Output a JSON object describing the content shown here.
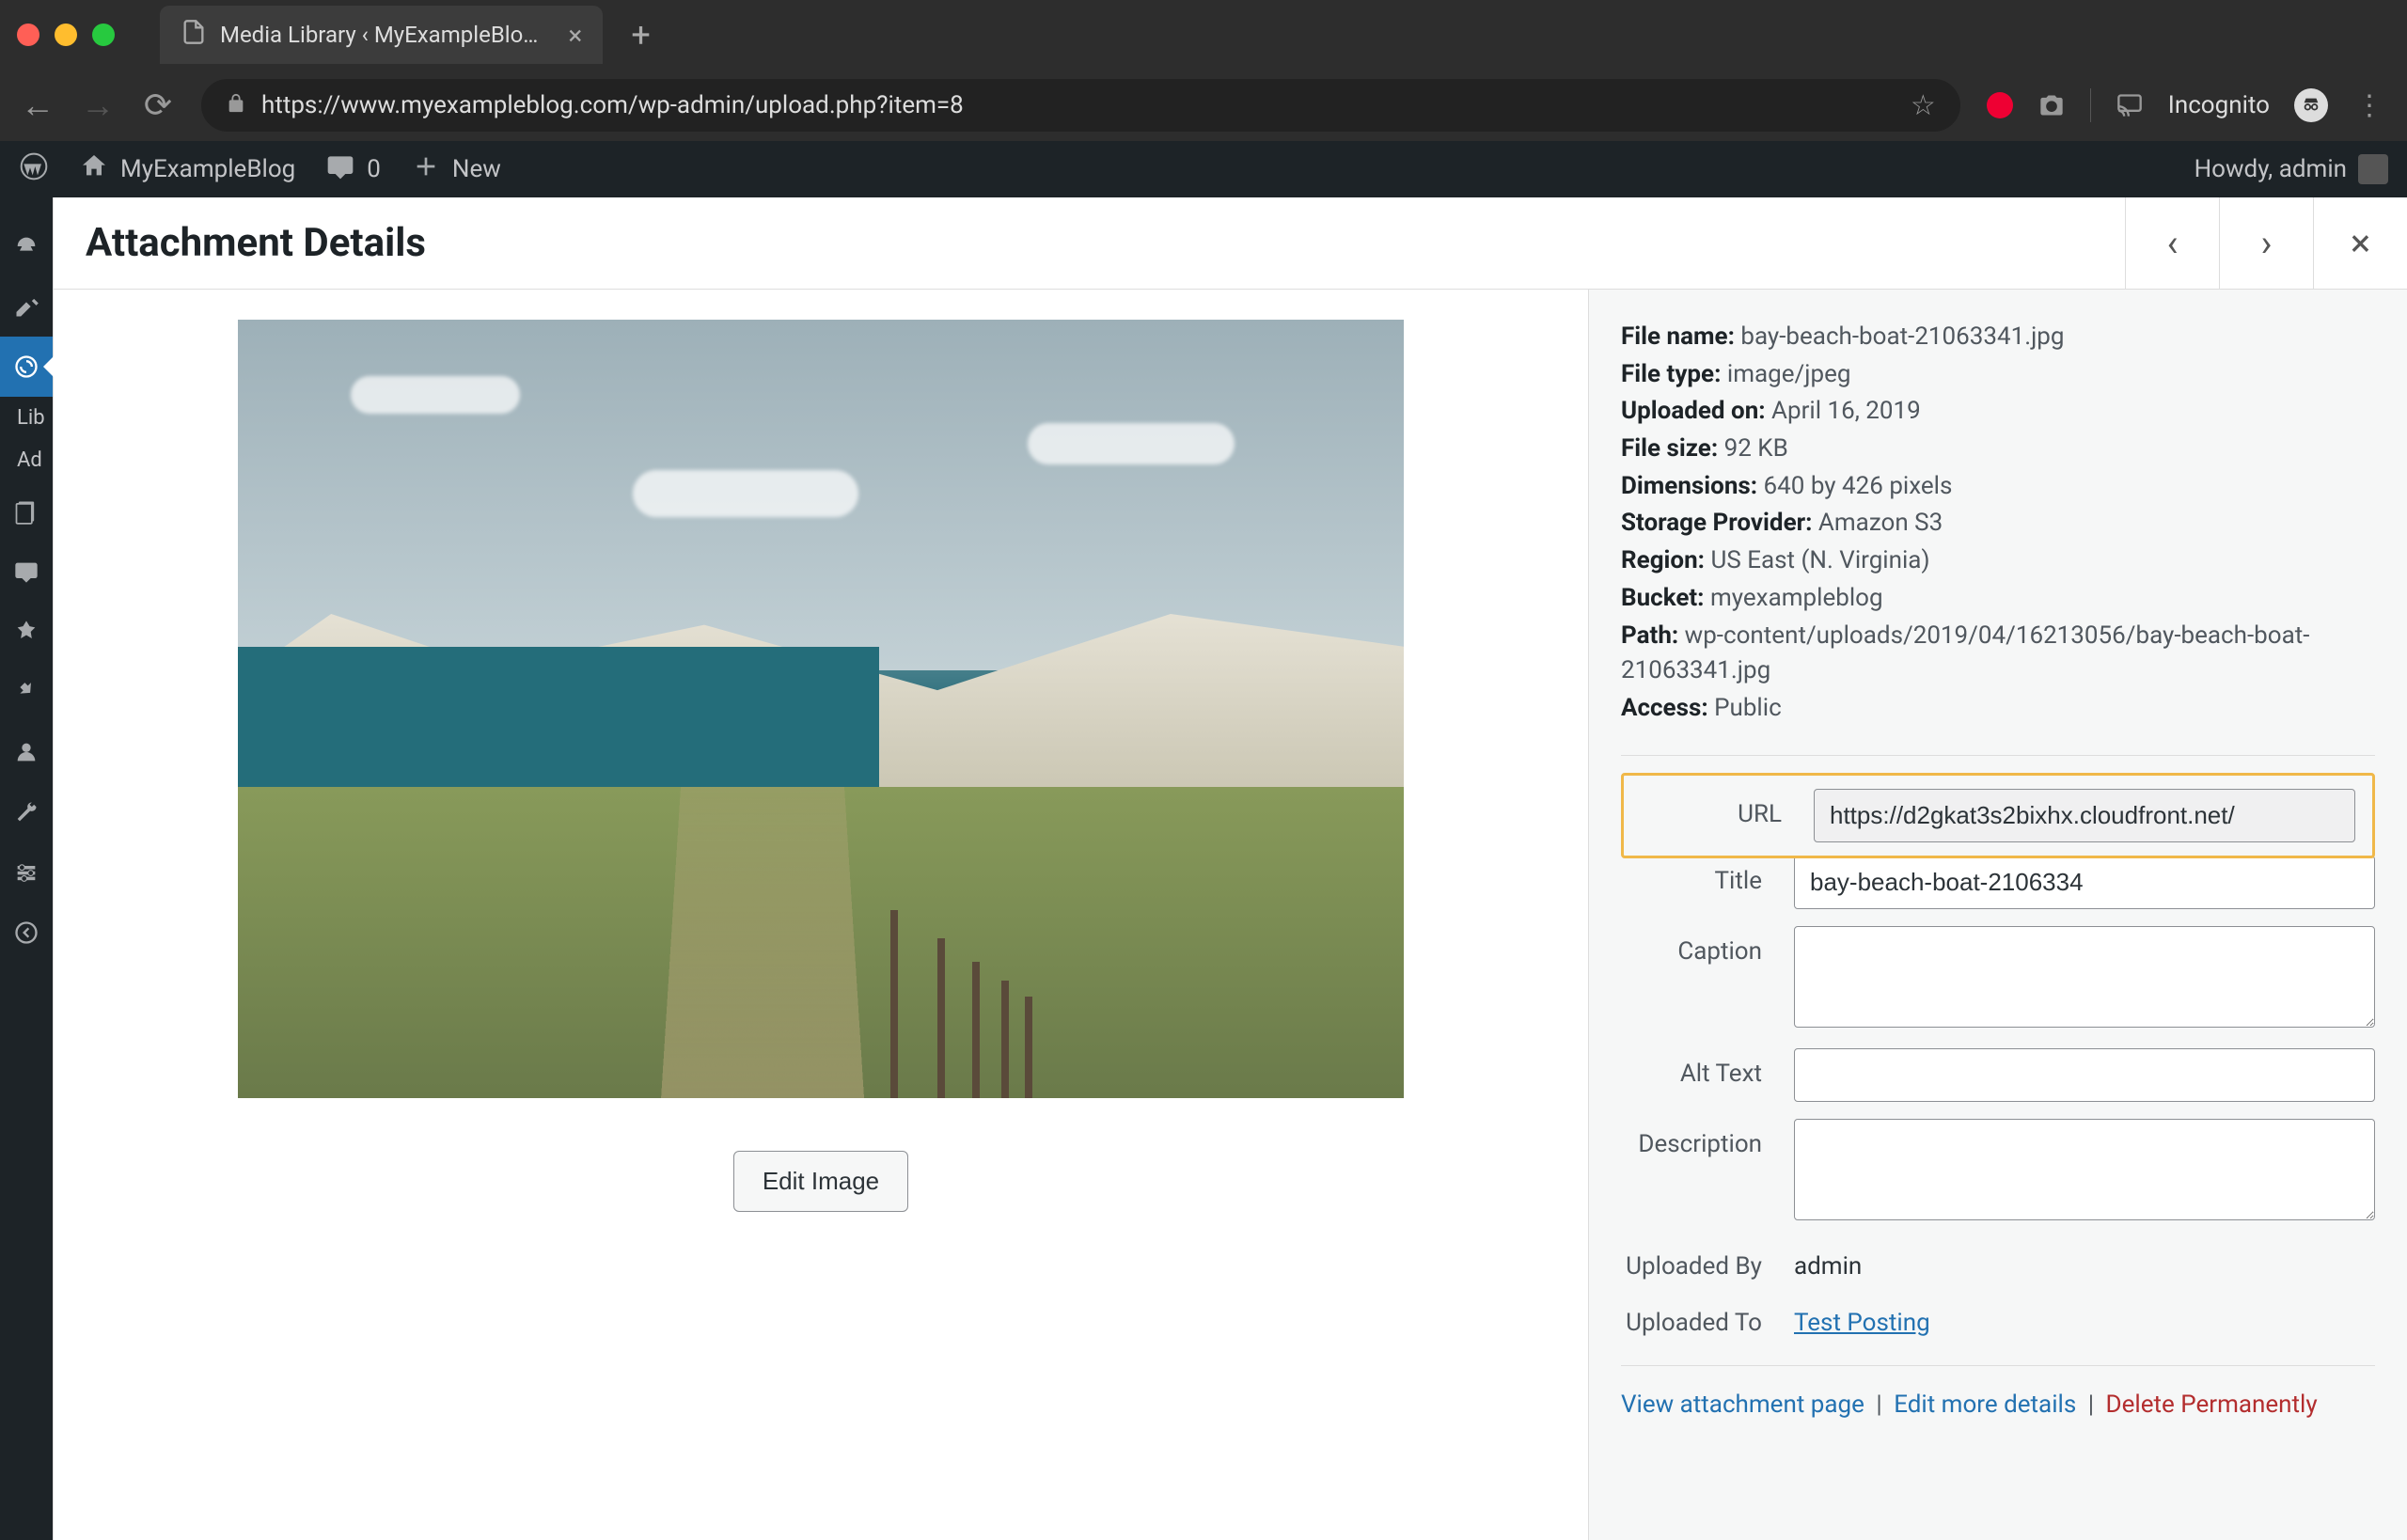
{
  "browser": {
    "tab_title": "Media Library ‹ MyExampleBlo…",
    "url": "https://www.myexampleblog.com/wp-admin/upload.php?item=8",
    "incognito_label": "Incognito"
  },
  "adminbar": {
    "site_name": "MyExampleBlog",
    "comments_count": "0",
    "new_label": "New",
    "howdy": "Howdy, admin"
  },
  "sidebar": {
    "sub1": "Lib",
    "sub2": "Ad"
  },
  "modal": {
    "title": "Attachment Details"
  },
  "meta": {
    "file_name_label": "File name:",
    "file_name_value": "bay-beach-boat-21063341.jpg",
    "file_type_label": "File type:",
    "file_type_value": "image/jpeg",
    "uploaded_on_label": "Uploaded on:",
    "uploaded_on_value": "April 16, 2019",
    "file_size_label": "File size:",
    "file_size_value": "92 KB",
    "dimensions_label": "Dimensions:",
    "dimensions_value": "640 by 426 pixels",
    "storage_provider_label": "Storage Provider:",
    "storage_provider_value": "Amazon S3",
    "region_label": "Region:",
    "region_value": "US East (N. Virginia)",
    "bucket_label": "Bucket:",
    "bucket_value": "myexampleblog",
    "path_label": "Path:",
    "path_value": "wp-content/uploads/2019/04/16213056/bay-beach-boat-21063341.jpg",
    "access_label": "Access:",
    "access_value": "Public"
  },
  "form": {
    "url_label": "URL",
    "url_value": "https://d2gkat3s2bixhx.cloudfront.net/",
    "title_label": "Title",
    "title_value": "bay-beach-boat-2106334",
    "caption_label": "Caption",
    "caption_value": "",
    "alt_text_label": "Alt Text",
    "alt_text_value": "",
    "description_label": "Description",
    "description_value": "",
    "uploaded_by_label": "Uploaded By",
    "uploaded_by_value": "admin",
    "uploaded_to_label": "Uploaded To",
    "uploaded_to_link": "Test Posting"
  },
  "buttons": {
    "edit_image": "Edit Image"
  },
  "actions": {
    "view_page": "View attachment page",
    "edit_more": "Edit more details",
    "delete": "Delete Permanently"
  }
}
